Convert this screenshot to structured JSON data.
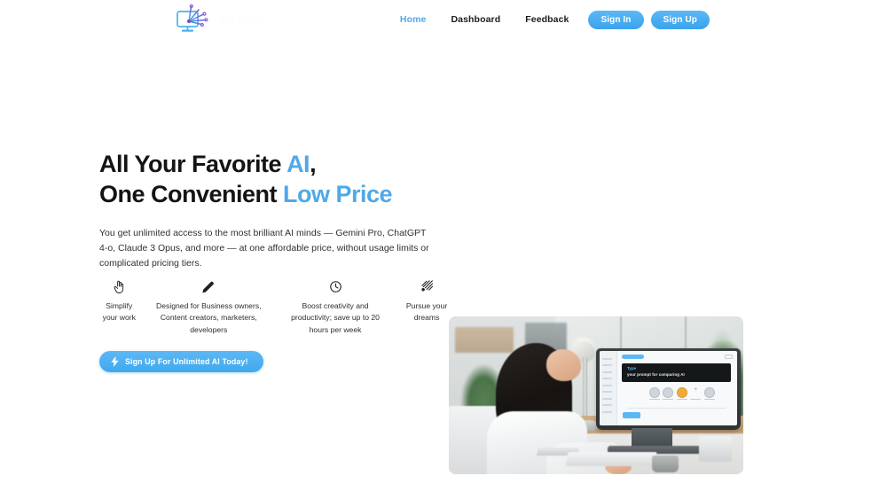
{
  "brand": {
    "wordmark": "AI Hub",
    "logo_icon": "monitor-circuit-logo-icon"
  },
  "nav": {
    "links": [
      {
        "label": "Home",
        "active": true
      },
      {
        "label": "Dashboard",
        "active": false
      },
      {
        "label": "Feedback",
        "active": false
      }
    ],
    "sign_in_label": "Sign In",
    "sign_up_label": "Sign Up"
  },
  "hero": {
    "headline_line1_plain": "All Your Favorite ",
    "headline_line1_accent": "AI",
    "headline_line1_tail": ",",
    "headline_line2_plain": "One Convenient ",
    "headline_line2_accent": "Low Price",
    "subtext": "You get unlimited access to the most brilliant AI minds — Gemini Pro, ChatGPT 4-o, Claude 3 Opus, and more — at one affordable price, without usage limits or complicated pricing tiers.",
    "cta_label": "Sign Up For Unlimited AI Today!",
    "cta_icon": "lightning-bolt-icon"
  },
  "features": [
    {
      "icon": "pointing-hand-icon",
      "text": "Simplify your work"
    },
    {
      "icon": "pencil-icon",
      "text": "Designed for Business owners, Content creators, marketers, developers"
    },
    {
      "icon": "clock-icon",
      "text": "Boost creativity and productivity; save up to 20 hours per week"
    },
    {
      "icon": "comet-icon",
      "text": "Pursue your dreams"
    }
  ],
  "hero_image": {
    "alt": "Woman at desk working on a monitor showing an AI prompt comparison app",
    "screen": {
      "prompt_line1": "Type",
      "prompt_line2": "your prompt for comparing AI"
    }
  },
  "colors": {
    "accent_blue": "#4fa9e8",
    "button_blue": "#5cb8f5",
    "text_dark": "#141417",
    "body_text": "#2f3034",
    "page_bg": "#ffffff"
  }
}
